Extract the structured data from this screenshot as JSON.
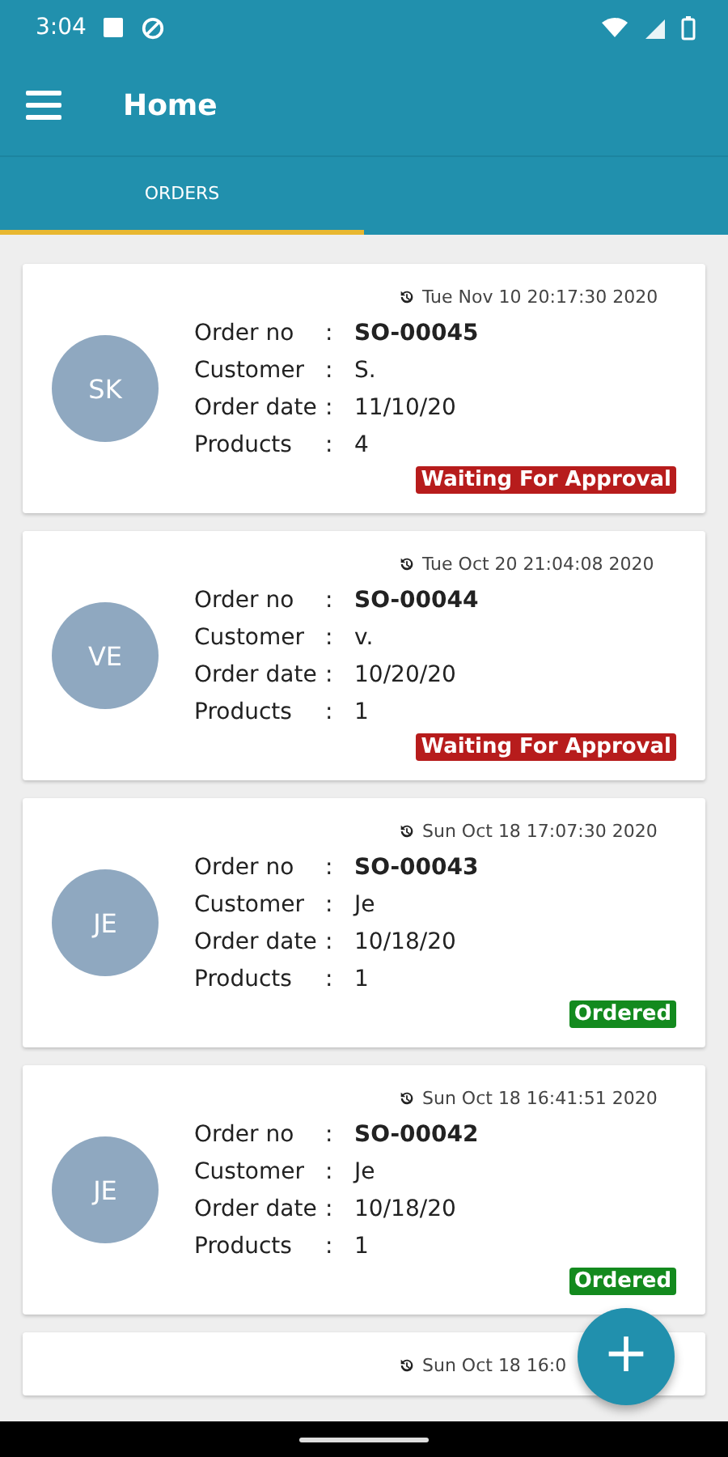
{
  "status_bar": {
    "time": "3:04"
  },
  "app_bar": {
    "title": "Home"
  },
  "tabs": [
    {
      "label": "ORDERS",
      "selected": true
    }
  ],
  "orders": [
    {
      "timestamp": "Tue Nov 10 20:17:30 2020",
      "initials": "SK",
      "fields": [
        {
          "label": "Order no",
          "colon": ":",
          "value": "SO-00045"
        },
        {
          "label": "Customer",
          "colon": ":",
          "value": "S."
        },
        {
          "label": "Order date",
          "colon": ":",
          "value": "11/10/20"
        },
        {
          "label": "Products",
          "colon": ":",
          "value": "4"
        }
      ],
      "status": {
        "text": "Waiting For Approval",
        "color": "#b71c1c"
      }
    },
    {
      "timestamp": "Tue Oct 20 21:04:08 2020",
      "initials": "VE",
      "fields": [
        {
          "label": "Order no",
          "colon": ":",
          "value": "SO-00044"
        },
        {
          "label": "Customer",
          "colon": ":",
          "value": "v."
        },
        {
          "label": "Order date",
          "colon": ":",
          "value": "10/20/20"
        },
        {
          "label": "Products",
          "colon": ":",
          "value": "1"
        }
      ],
      "status": {
        "text": "Waiting For Approval",
        "color": "#b71c1c"
      }
    },
    {
      "timestamp": "Sun Oct 18 17:07:30 2020",
      "initials": "JE",
      "fields": [
        {
          "label": "Order no",
          "colon": ":",
          "value": "SO-00043"
        },
        {
          "label": "Customer",
          "colon": ":",
          "value": "Je"
        },
        {
          "label": "Order date",
          "colon": ":",
          "value": "10/18/20"
        },
        {
          "label": "Products",
          "colon": ":",
          "value": "1"
        }
      ],
      "status": {
        "text": "Ordered",
        "color": "#138a1e"
      }
    },
    {
      "timestamp": "Sun Oct 18 16:41:51 2020",
      "initials": "JE",
      "fields": [
        {
          "label": "Order no",
          "colon": ":",
          "value": "SO-00042"
        },
        {
          "label": "Customer",
          "colon": ":",
          "value": "Je"
        },
        {
          "label": "Order date",
          "colon": ":",
          "value": "10/18/20"
        },
        {
          "label": "Products",
          "colon": ":",
          "value": "1"
        }
      ],
      "status": {
        "text": "Ordered",
        "color": "#138a1e"
      }
    },
    {
      "timestamp": "Sun Oct 18 16:0"
    }
  ],
  "fab": {
    "label": "+"
  }
}
